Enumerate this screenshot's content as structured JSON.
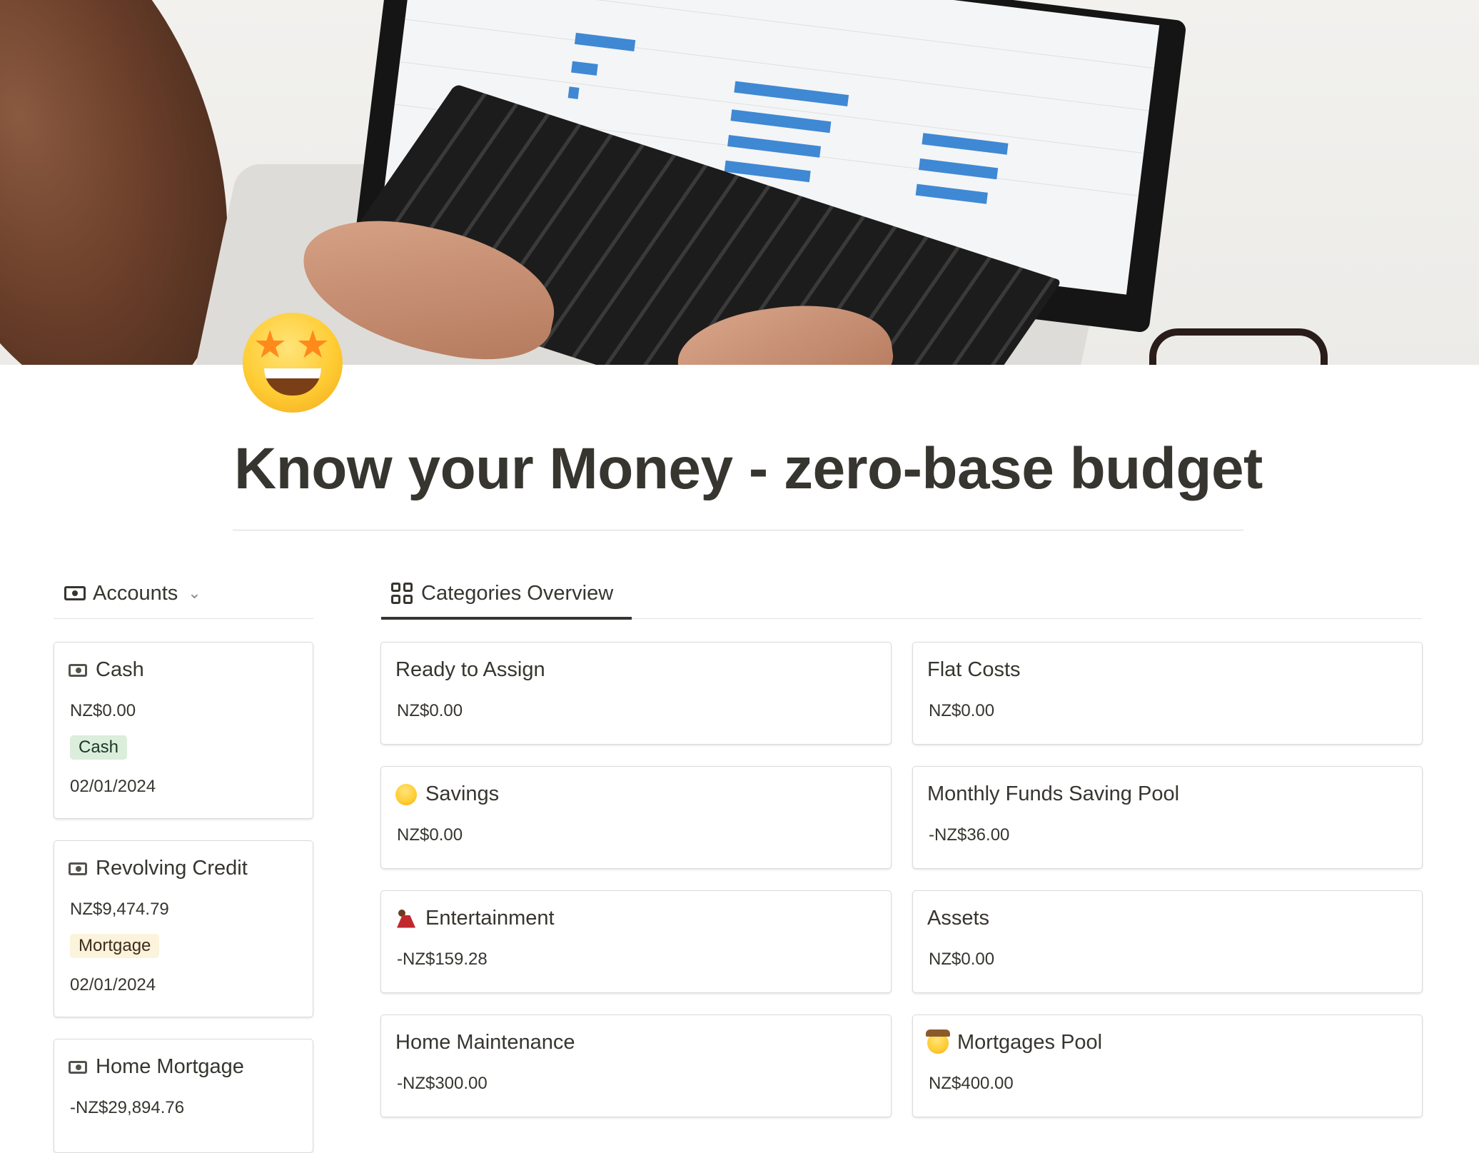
{
  "page": {
    "title": "Know your Money - zero-base budget",
    "icon": "star-struck-emoji",
    "cover": "laptop-analytics-photo"
  },
  "accounts_view": {
    "label": "Accounts",
    "icon": "money-icon",
    "cards": [
      {
        "name": "Cash",
        "balance": "NZ$0.00",
        "type": "Cash",
        "type_color": "#dbeddb",
        "date": "02/01/2024"
      },
      {
        "name": "Revolving Credit",
        "balance": "NZ$9,474.79",
        "type": "Mortgage",
        "type_color": "#fbf3db",
        "date": "02/01/2024"
      },
      {
        "name": "Home Mortgage",
        "balance": "-NZ$29,894.76"
      }
    ]
  },
  "categories_view": {
    "label": "Categories Overview",
    "icon": "gallery-grid-icon",
    "cards": [
      {
        "name": "Ready to Assign",
        "amount": "NZ$0.00"
      },
      {
        "name": "Flat Costs",
        "amount": "NZ$0.00"
      },
      {
        "name": "Savings",
        "amount": "NZ$0.00",
        "icon": "star-struck-emoji"
      },
      {
        "name": "Monthly Funds Saving Pool",
        "amount": "-NZ$36.00"
      },
      {
        "name": "Entertainment",
        "amount": "-NZ$159.28",
        "icon": "dancer-emoji"
      },
      {
        "name": "Assets",
        "amount": "NZ$0.00"
      },
      {
        "name": "Home Maintenance",
        "amount": "-NZ$300.00"
      },
      {
        "name": "Mortgages Pool",
        "amount": "NZ$400.00",
        "icon": "cowboy-emoji"
      }
    ]
  }
}
